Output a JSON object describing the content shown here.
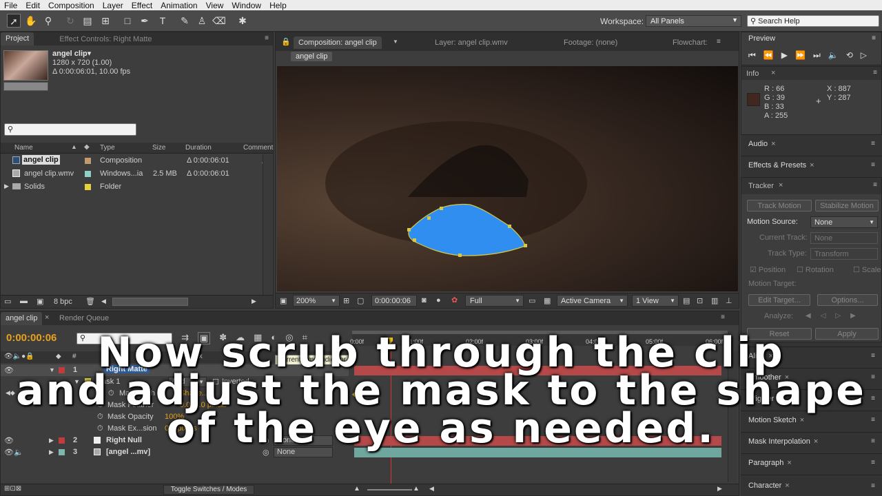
{
  "menubar": {
    "items": [
      "File",
      "Edit",
      "Composition",
      "Layer",
      "Effect",
      "Animation",
      "View",
      "Window",
      "Help"
    ]
  },
  "toolbar": {
    "workspace_label": "Workspace:",
    "workspace_value": "All Panels",
    "search_placeholder": "Search Help"
  },
  "project": {
    "tab_project": "Project",
    "tab_effect_controls": "Effect Controls: Right Matte",
    "thumb_name": "angel clip▾",
    "thumb_info1": "1280 x 720 (1.00)",
    "thumb_info2": "Δ 0:00:06:01, 10.00 fps",
    "columns": [
      "Name",
      "Type",
      "Size",
      "Duration",
      "Comment"
    ],
    "rows": [
      {
        "name": "angel clip",
        "type": "Composition",
        "size": "",
        "duration": "Δ 0:00:06:01",
        "color": "#c29a6b"
      },
      {
        "name": "angel clip.wmv",
        "type": "Windows...ia",
        "size": "2.5 MB",
        "duration": "Δ 0:00:06:01",
        "color": "#8fd0c8"
      },
      {
        "name": "Solids",
        "type": "Folder",
        "size": "",
        "duration": "",
        "color": "#e3d23c"
      }
    ],
    "bpc": "8 bpc"
  },
  "composition": {
    "tab_comp": "Composition: angel clip",
    "tab_layer": "Layer: angel clip.wmv",
    "tab_footage": "Footage: (none)",
    "tab_flowchart": "Flowchart:",
    "breadcrumb": "angel clip",
    "zoom": "200%",
    "timecode": "0:00:00:06",
    "resolution": "Full",
    "camera": "Active Camera",
    "views": "1 View"
  },
  "preview": {
    "title": "Preview"
  },
  "info": {
    "title": "Info",
    "r": "R : 66",
    "g": "G : 39",
    "b": "B : 33",
    "a": "A : 255",
    "x": "X : 887",
    "y": "Y : 287",
    "swatch": "#422721"
  },
  "panels": {
    "audio": "Audio",
    "effects": "Effects & Presets",
    "tracker": "Tracker",
    "align": "Align",
    "smoother": "Smoother",
    "wiggler": "Wiggler",
    "motion_sketch": "Motion Sketch",
    "mask_interp": "Mask Interpolation",
    "paragraph": "Paragraph",
    "character": "Character"
  },
  "tracker": {
    "track_motion": "Track Motion",
    "stabilize_motion": "Stabilize Motion",
    "motion_source_label": "Motion Source:",
    "motion_source_value": "None",
    "current_track_label": "Current Track:",
    "current_track_value": "None",
    "track_type_label": "Track Type:",
    "track_type_value": "Transform",
    "position": "Position",
    "rotation": "Rotation",
    "scale": "Scale",
    "motion_target": "Motion Target:",
    "edit_target": "Edit Target...",
    "options": "Options...",
    "analyze": "Analyze:",
    "reset": "Reset",
    "apply": "Apply"
  },
  "timeline": {
    "tab_comp": "angel clip",
    "tab_render": "Render Queue",
    "timecode": "0:00:00:06",
    "ruler": [
      "0:00f",
      "01:00f",
      "02:00f",
      "03:00f",
      "04:00f",
      "05:00f",
      "06:00f"
    ],
    "tooltip": "Current Time Indicator",
    "layers": [
      {
        "num": "1",
        "name": "Right Matte",
        "color": "#c23c3c"
      },
      {
        "num": "2",
        "name": "Right Null",
        "color": "#c23c3c",
        "parent": "None"
      },
      {
        "num": "3",
        "name": "[angel ...mv]",
        "color": "#7fb7b0",
        "parent": "None"
      }
    ],
    "mask_name": "Mask 1",
    "mask_mode": "Add",
    "inverted": "Inverted",
    "mask_props": [
      "Mask Path",
      "Mask Feather",
      "Mask Opacity",
      "Mask Expansion"
    ],
    "mask_props_shown": [
      "Mask Path",
      "Mask Feather",
      "Mask Opacity",
      "Mask Ex...sion"
    ],
    "mask_values": [
      "Shape...",
      "0.0, 0.0 pixels",
      "100%",
      "0.0 pixels"
    ],
    "toggle": "Toggle Switches / Modes"
  },
  "caption": {
    "line1": "Now scrub through the clip",
    "line2": "and adjust the mask to the shape",
    "line3": "of the eye as needed."
  },
  "colors": {
    "mask": "#2f8ef0",
    "timecode": "#e8a21c",
    "bar_red": "#b54848",
    "bar_teal": "#6fa79f"
  }
}
